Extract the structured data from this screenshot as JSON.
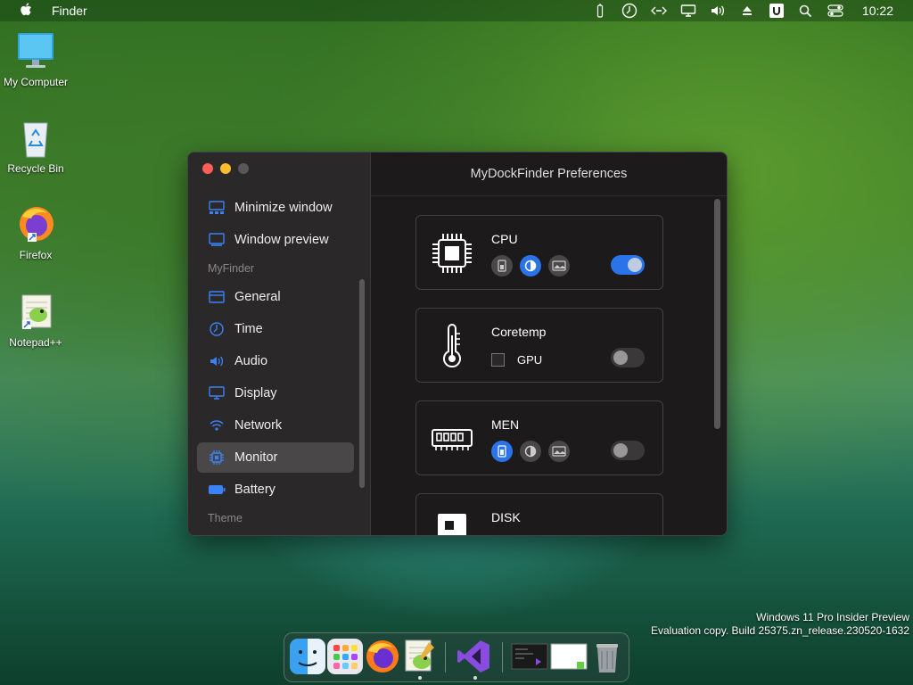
{
  "menubar": {
    "app_name": "Finder",
    "clock": "10:22",
    "status_icons": [
      "battery-icon",
      "clock-icon",
      "code-icon",
      "monitor-icon",
      "volume-icon",
      "eject-icon",
      "u-badge-icon",
      "search-icon",
      "control-center-icon"
    ]
  },
  "desktop": {
    "icons": [
      {
        "label": "My Computer"
      },
      {
        "label": "Recycle Bin"
      },
      {
        "label": "Firefox"
      },
      {
        "label": "Notepad++"
      }
    ]
  },
  "window": {
    "title": "MyDockFinder Preferences",
    "sidebar": {
      "items_top": [
        {
          "label": "Minimize window",
          "icon": "minimize-window-icon"
        },
        {
          "label": "Window preview",
          "icon": "window-preview-icon"
        }
      ],
      "section_myfinder": "MyFinder",
      "items_myfinder": [
        {
          "label": "General",
          "icon": "general-icon"
        },
        {
          "label": "Time",
          "icon": "time-icon"
        },
        {
          "label": "Audio",
          "icon": "audio-icon"
        },
        {
          "label": "Display",
          "icon": "display-icon"
        },
        {
          "label": "Network",
          "icon": "network-icon"
        },
        {
          "label": "Monitor",
          "icon": "monitor-icon",
          "active": true
        },
        {
          "label": "Battery",
          "icon": "battery-icon"
        }
      ],
      "section_theme": "Theme"
    },
    "cards": [
      {
        "title": "CPU",
        "icon": "cpu-icon",
        "style_selected": "donut",
        "enabled": true
      },
      {
        "title": "Coretemp",
        "icon": "thermometer-icon",
        "checkbox_label": "GPU",
        "checkbox_checked": false,
        "enabled": false
      },
      {
        "title": "MEN",
        "icon": "memory-icon",
        "style_selected": "bar",
        "enabled": false
      },
      {
        "title": "DISK",
        "icon": "disk-icon"
      }
    ]
  },
  "watermark": {
    "line1": "Windows 11 Pro Insider Preview",
    "line2": "Evaluation copy. Build 25375.zn_release.230520-1632"
  },
  "dock": {
    "apps": [
      "finder-icon",
      "launchpad-icon",
      "firefox-icon",
      "notepadplusplus-icon",
      "visual-studio-icon",
      "terminal-window-thumbnail",
      "window-thumbnail",
      "trash-icon"
    ]
  },
  "colors": {
    "accent": "#2a73e8",
    "window_bg": "#1d1a1b",
    "sidebar_bg": "#2a2829"
  }
}
